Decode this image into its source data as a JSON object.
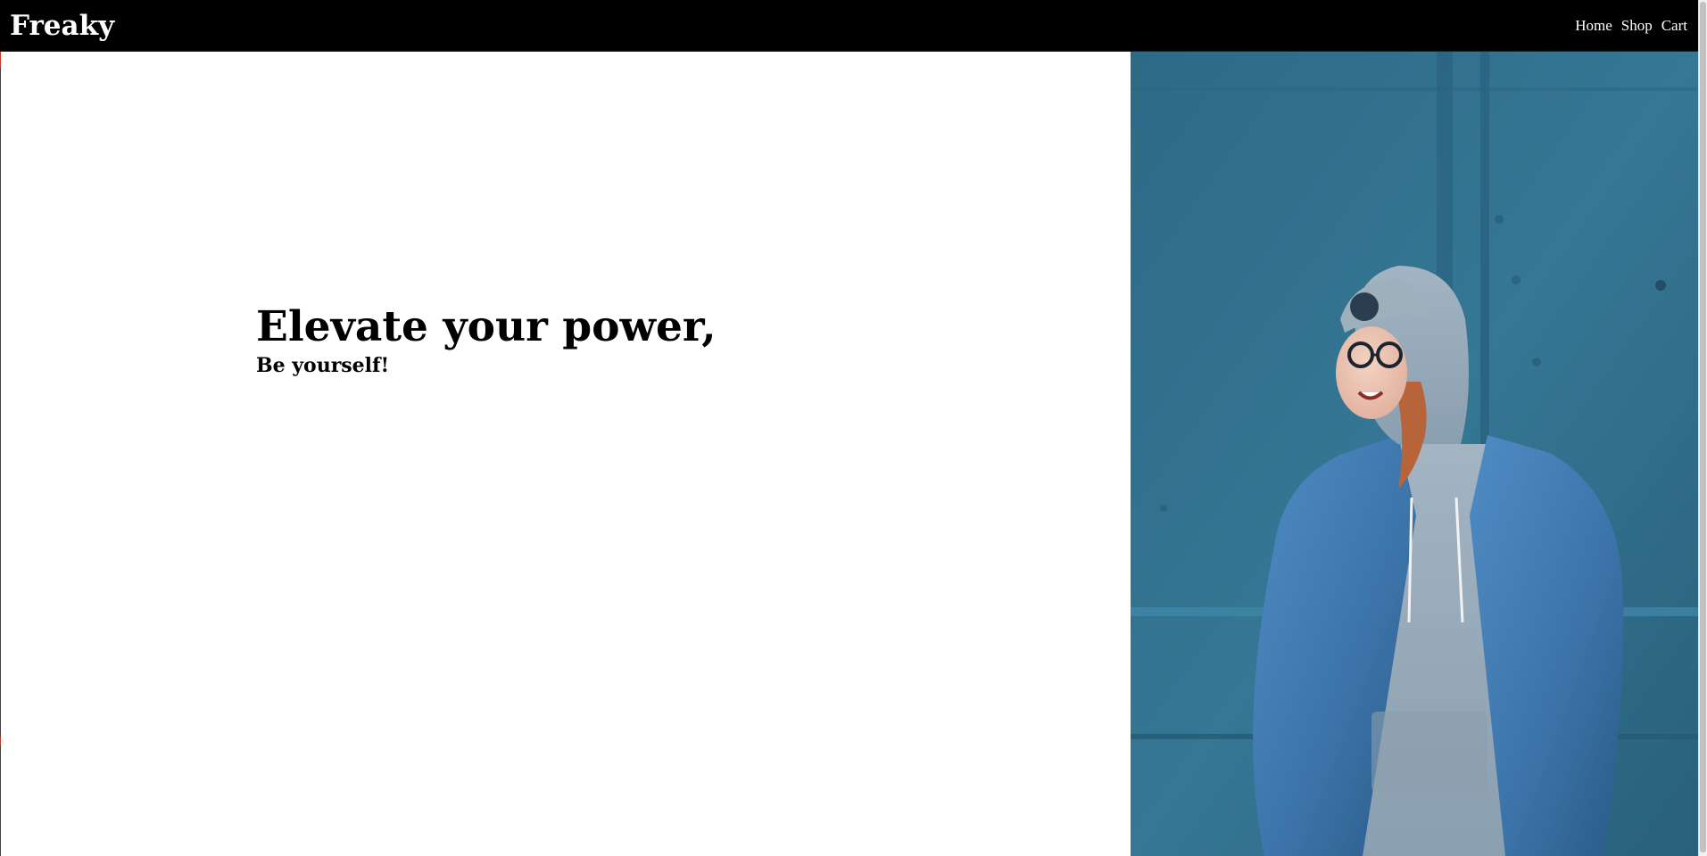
{
  "navbar": {
    "brand": "Freaky",
    "links": [
      {
        "label": "Home"
      },
      {
        "label": "Shop"
      },
      {
        "label": "Cart"
      }
    ]
  },
  "hero": {
    "title": "Elevate your power,",
    "subtitle": "Be yourself!"
  },
  "colors": {
    "navbar_bg": "#000000",
    "nav_text": "#ffffff",
    "photo_wall": "#2f6b86"
  }
}
